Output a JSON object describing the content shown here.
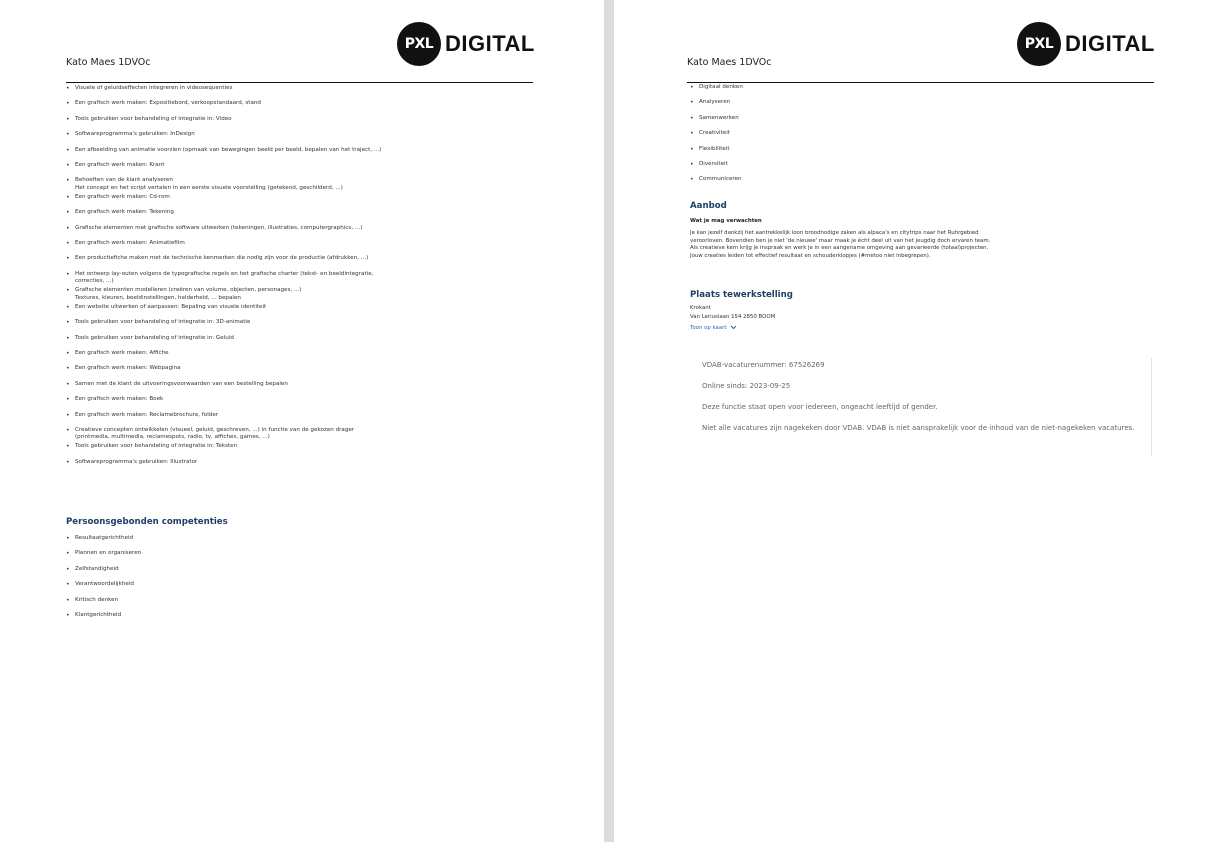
{
  "left_page": {
    "logo": {
      "mark": "PXL",
      "word": "DIGITAL"
    },
    "author": "Kato Maes 1DVOc",
    "competences": [
      [
        "Visuele of geluidseffecten integreren in videosequenties"
      ],
      [
        "Een grafisch werk maken: Expositiebord, verkoopstandaard, stand"
      ],
      [
        "Tools gebruiken voor behandeling of integratie in: Video"
      ],
      [
        "Softwareprogramma's gebruiken: InDesign"
      ],
      [
        "Een afbeelding van animatie voorzien (opmaak van bewegingen beeld per beeld, bepalen van het traject, ...)"
      ],
      [
        "Een grafisch werk maken: Krant"
      ],
      [
        "Behoeften van de klant analyseren",
        "Het concept en het script vertalen in een eerste visuele voorstelling (getekend, geschilderd, ...)"
      ],
      [
        "Een grafisch werk maken: Cd-rom"
      ],
      [
        "Een grafisch werk maken: Tekening"
      ],
      [
        "Grafische elementen met grafische software uitwerken (tekeningen, illustraties, computergraphics, ...)"
      ],
      [
        "Een grafisch werk maken: Animatiefilm"
      ],
      [
        "Een productiefiche maken met de technische kenmerken die nodig zijn voor de productie (afdrukken, ...)"
      ],
      [
        "Het ontwerp lay-outen volgens de typografische regels en het grafische charter (tekst- en beeldintegratie,",
        "correcties, ...)"
      ],
      [
        "Grafische elementen modelleren (creëren van volume, objecten, personages, ...)",
        "Textures, kleuren, beeldinstellingen, helderheid, ... bepalen"
      ],
      [
        "Een website uitwerken of aanpassen: Bepaling van visuele identiteit"
      ],
      [
        "Tools gebruiken voor behandeling of integratie in: 3D-animatie"
      ],
      [
        "Tools gebruiken voor behandeling of integratie in: Geluid"
      ],
      [
        "Een grafisch werk maken: Affiche"
      ],
      [
        "Een grafisch werk maken: Webpagina"
      ],
      [
        "Samen met de klant de uitvoeringsvoorwaarden van een bestelling bepalen"
      ],
      [
        "Een grafisch werk maken: Boek"
      ],
      [
        "Een grafisch werk maken: Reclamebrochure, folder"
      ],
      [
        "Creatieve concepten ontwikkelen (visueel, geluid, geschreven, ...) in functie van de gekozen drager",
        "(printmedia, multimedia, reclamespots, radio, tv, affiches, games, ...)"
      ],
      [
        "Tools gebruiken voor behandeling of integratie in: Teksten"
      ],
      [
        "Softwareprogramma's gebruiken: Illustrator"
      ]
    ],
    "personal_title": "Persoonsgebonden competenties",
    "personal": [
      "Resultaatgerichtheid",
      "Plannen en organiseren",
      "Zelfstandigheid",
      "Verantwoordelijkheid",
      "Kritisch denken",
      "Klantgerichtheid"
    ]
  },
  "right_page": {
    "logo": {
      "mark": "PXL",
      "word": "DIGITAL"
    },
    "author": "Kato Maes 1DVOc",
    "skills": [
      "Digitaal denken",
      "Analyseren",
      "Samenwerken",
      "Creativiteit",
      "Flexibiliteit",
      "Diversiteit",
      "Communiceren"
    ],
    "aanbod_title": "Aanbod",
    "aanbod_sub": "Wat je mag verwachten",
    "aanbod_lines": [
      "Je kan jezelf dankzij het aantrekkelijk loon broodnodige zaken als alpaca's en citytrips naar het Ruhrgebied",
      "veroorloven. Bovendien ben je niet 'de nieuwe' maar maak je écht deel uit van het jeugdig doch ervaren team.",
      "Als creatieve kern krijg je inspraak en werk je in een aangename omgeving aan gevarieerde (totaal)projecten.",
      "Jouw creaties leiden tot effectief resultaat en schouderklopjes (#metoo niet inbegrepen)."
    ],
    "plaats_title": "Plaats tewerkstelling",
    "company": "Krokant",
    "address": "Van Leriuslaan 154 2850 BOOM",
    "map_link": "Toon op kaart",
    "map_link_icon": "chevron-down-icon",
    "meta": {
      "vacature": "VDAB-vacaturenummer: 67526269",
      "online": "Online sinds: 2023-09-25",
      "open": "Deze functie staat open voor iedereen, ongeacht leeftijd of gender.",
      "disclaimer": "Niet alle vacatures zijn nagekeken door VDAB. VDAB is niet aansprakelijk voor de inhoud van de niet-nagekeken vacatures."
    }
  }
}
